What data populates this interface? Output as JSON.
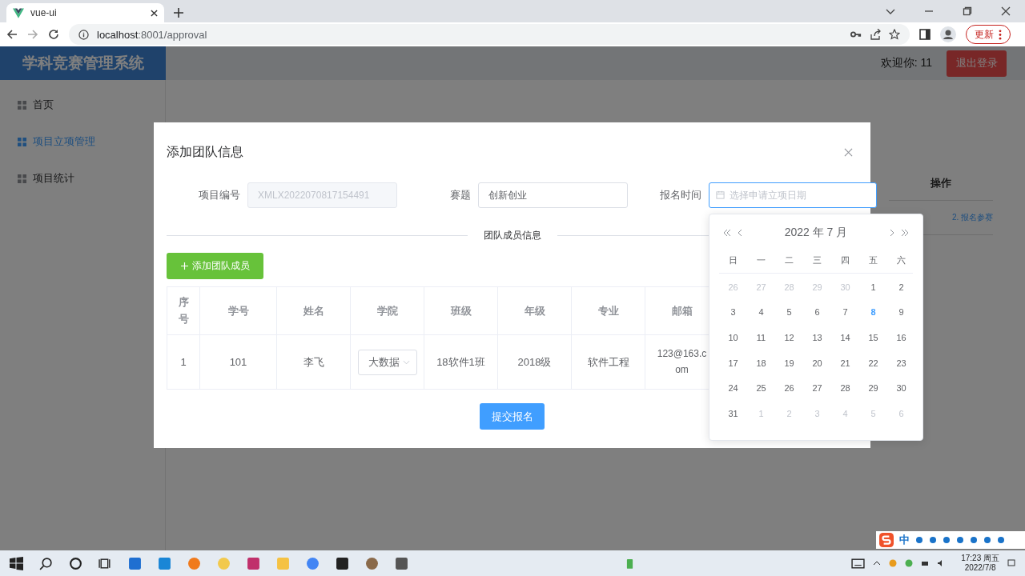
{
  "browser": {
    "tab_title": "vue-ui",
    "url_host": "localhost",
    "url_rest": ":8001/approval",
    "update_button": "更新"
  },
  "app": {
    "title": "学科竞赛管理系统",
    "welcome": "欢迎你: 11",
    "logout_button": "退出登录",
    "sidebar": {
      "items": [
        {
          "label": "首页",
          "selected": false
        },
        {
          "label": "项目立项管理",
          "selected": true
        },
        {
          "label": "项目统计",
          "selected": false
        }
      ]
    },
    "background_table": {
      "header": "操作",
      "link": "2. 报名参赛"
    }
  },
  "modal": {
    "title": "添加团队信息",
    "fields": [
      {
        "label": "项目编号",
        "kind": "text",
        "value": "XMLX2022070817154491",
        "disabled": true,
        "focused": false
      },
      {
        "label": "赛题",
        "kind": "text",
        "value": "创新创业",
        "disabled": false,
        "focused": false
      },
      {
        "label": "报名时间",
        "kind": "date",
        "placeholder": "选择申请立项日期",
        "disabled": false,
        "focused": true
      }
    ],
    "divider": "团队成员信息",
    "add_button": "添加团队成员",
    "table": {
      "columns": [
        "序号",
        "学号",
        "姓名",
        "学院",
        "班级",
        "年级",
        "专业",
        "邮箱"
      ],
      "rows": [
        {
          "number": "1",
          "student_id": "101",
          "name": "李飞",
          "college": "大数据",
          "class": "18软件1班",
          "grade": "2018级",
          "major": "软件工程",
          "email": "123@163.com"
        }
      ]
    },
    "submit_button": "提交报名"
  },
  "calendar": {
    "year_month": "2022 年 7 月",
    "weekdays": [
      "日",
      "一",
      "二",
      "三",
      "四",
      "五",
      "六"
    ],
    "days": [
      {
        "day": "26",
        "outside_month": true,
        "today": false
      },
      {
        "day": "27",
        "outside_month": true,
        "today": false
      },
      {
        "day": "28",
        "outside_month": true,
        "today": false
      },
      {
        "day": "29",
        "outside_month": true,
        "today": false
      },
      {
        "day": "30",
        "outside_month": true,
        "today": false
      },
      {
        "day": "1",
        "outside_month": false,
        "today": false
      },
      {
        "day": "2",
        "outside_month": false,
        "today": false
      },
      {
        "day": "3",
        "outside_month": false,
        "today": false
      },
      {
        "day": "4",
        "outside_month": false,
        "today": false
      },
      {
        "day": "5",
        "outside_month": false,
        "today": false
      },
      {
        "day": "6",
        "outside_month": false,
        "today": false
      },
      {
        "day": "7",
        "outside_month": false,
        "today": false
      },
      {
        "day": "8",
        "outside_month": false,
        "today": true
      },
      {
        "day": "9",
        "outside_month": false,
        "today": false
      },
      {
        "day": "10",
        "outside_month": false,
        "today": false
      },
      {
        "day": "11",
        "outside_month": false,
        "today": false
      },
      {
        "day": "12",
        "outside_month": false,
        "today": false
      },
      {
        "day": "13",
        "outside_month": false,
        "today": false
      },
      {
        "day": "14",
        "outside_month": false,
        "today": false
      },
      {
        "day": "15",
        "outside_month": false,
        "today": false
      },
      {
        "day": "16",
        "outside_month": false,
        "today": false
      },
      {
        "day": "17",
        "outside_month": false,
        "today": false
      },
      {
        "day": "18",
        "outside_month": false,
        "today": false
      },
      {
        "day": "19",
        "outside_month": false,
        "today": false
      },
      {
        "day": "20",
        "outside_month": false,
        "today": false
      },
      {
        "day": "21",
        "outside_month": false,
        "today": false
      },
      {
        "day": "22",
        "outside_month": false,
        "today": false
      },
      {
        "day": "23",
        "outside_month": false,
        "today": false
      },
      {
        "day": "24",
        "outside_month": false,
        "today": false
      },
      {
        "day": "25",
        "outside_month": false,
        "today": false
      },
      {
        "day": "26",
        "outside_month": false,
        "today": false
      },
      {
        "day": "27",
        "outside_month": false,
        "today": false
      },
      {
        "day": "28",
        "outside_month": false,
        "today": false
      },
      {
        "day": "29",
        "outside_month": false,
        "today": false
      },
      {
        "day": "30",
        "outside_month": false,
        "today": false
      },
      {
        "day": "31",
        "outside_month": false,
        "today": false
      },
      {
        "day": "1",
        "outside_month": true,
        "today": false
      },
      {
        "day": "2",
        "outside_month": true,
        "today": false
      },
      {
        "day": "3",
        "outside_month": true,
        "today": false
      },
      {
        "day": "4",
        "outside_month": true,
        "today": false
      },
      {
        "day": "5",
        "outside_month": true,
        "today": false
      },
      {
        "day": "6",
        "outside_month": true,
        "today": false
      }
    ]
  },
  "taskbar": {
    "ime": "中",
    "time": "17:23 周五",
    "date": "2022/7/8"
  }
}
